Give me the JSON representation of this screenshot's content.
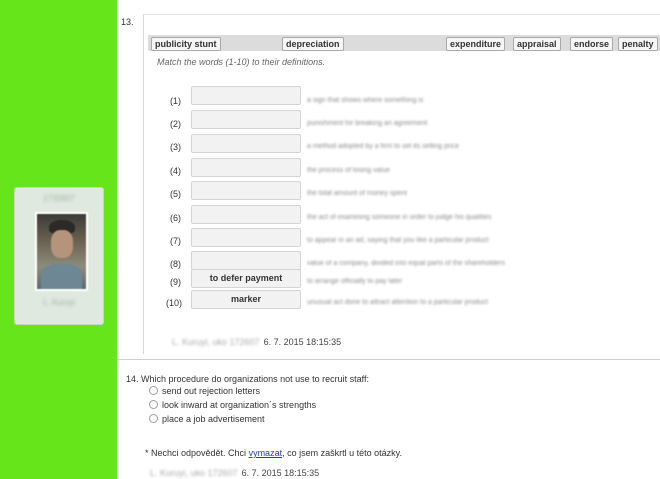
{
  "sidebar": {
    "user_id": "1732607",
    "user_name": "L. Kuruyi"
  },
  "q13": {
    "number": "13.",
    "word_bank": [
      "publicity stunt",
      "depreciation",
      "expenditure",
      "appraisal",
      "endorse",
      "penalty"
    ],
    "instruction": "Match the words (1-10) to their definitions.",
    "rows": [
      {
        "num": "(1)",
        "answer": "",
        "definition": "a sign that shows where something is"
      },
      {
        "num": "(2)",
        "answer": "",
        "definition": "punishment for breaking an agreement"
      },
      {
        "num": "(3)",
        "answer": "",
        "definition": "a method adopted by a firm to set its selling price"
      },
      {
        "num": "(4)",
        "answer": "",
        "definition": "the process of losing value"
      },
      {
        "num": "(5)",
        "answer": "",
        "definition": "the total amount of money spent"
      },
      {
        "num": "(6)",
        "answer": "",
        "definition": "the act of examining someone in order to judge his qualities"
      },
      {
        "num": "(7)",
        "answer": "",
        "definition": "to appear in an ad, saying that you like a particular product"
      },
      {
        "num": "(8)",
        "answer": "",
        "definition": "value of a company, divided into equal parts of the shareholders"
      },
      {
        "num": "(9)",
        "answer": "to defer payment",
        "definition": "to arrange officially to pay later"
      },
      {
        "num": "(10)",
        "answer": "marker",
        "definition": "unusual act done to attract attention to a particular product"
      }
    ],
    "submitter": "L. Kuruyi, uko 172607",
    "timestamp": "6. 7. 2015 18:15:35"
  },
  "q14": {
    "question": "14. Which procedure do organizations not use to recruit staff:",
    "options": [
      "send out rejection letters",
      "look inward at organization´s  strengths",
      "place a job advertisement"
    ],
    "note_before": "* Nechci odpovědět. Chci ",
    "note_link": "vymazat",
    "note_after": ", co jsem zaškrtl u této otázky.",
    "submitter": "L. Kuruyi, uko 172607",
    "timestamp": "6. 7. 2015 18:15:35"
  }
}
